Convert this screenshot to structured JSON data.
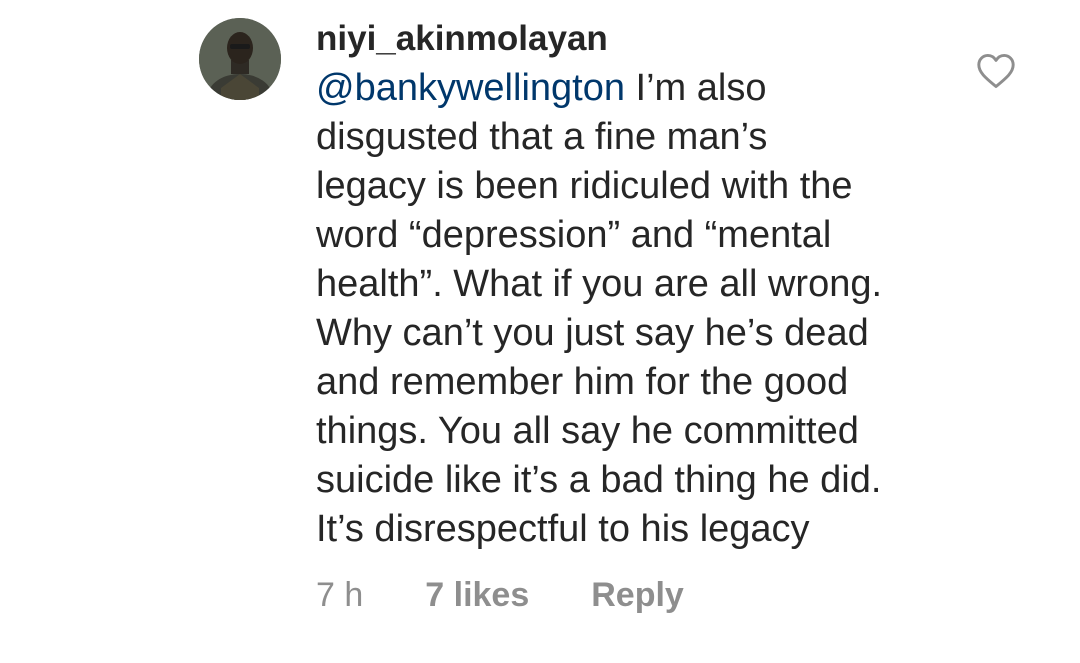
{
  "comment": {
    "username": "niyi_akinmolayan",
    "mention": "@bankywellington",
    "lines": [
      " I’m also",
      "disgusted that a fine man’s",
      "legacy is been ridiculed with the",
      "word “depression” and “mental",
      "health”. What if you are all wrong.",
      "Why can’t you just say he’s dead",
      "and remember him for the good",
      "things. You all say he committed",
      "suicide like it’s a bad thing he did.",
      "It’s disrespectful to his legacy"
    ],
    "time": "7 h",
    "likes": "7 likes",
    "reply": "Reply"
  },
  "icons": {
    "avatar": "user-avatar",
    "like": "heart-icon"
  },
  "colors": {
    "text": "#262626",
    "mention": "#00376b",
    "meta": "#8e8e8e"
  }
}
